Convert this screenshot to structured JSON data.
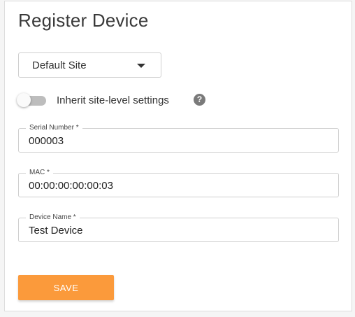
{
  "title": "Register Device",
  "site_select": {
    "value": "Default Site",
    "icon": "caret-down-icon"
  },
  "inherit_toggle": {
    "label": "Inherit site-level settings",
    "on": false,
    "help_icon": "question-circle-icon",
    "help_glyph": "?"
  },
  "fields": {
    "serial_number": {
      "label": "Serial Number *",
      "value": "000003"
    },
    "mac": {
      "label": "MAC *",
      "value": "00:00:00:00:00:03"
    },
    "device_name": {
      "label": "Device Name *",
      "value": "Test Device"
    }
  },
  "save_button": {
    "label": "SAVE",
    "color": "#fb9a3b"
  }
}
